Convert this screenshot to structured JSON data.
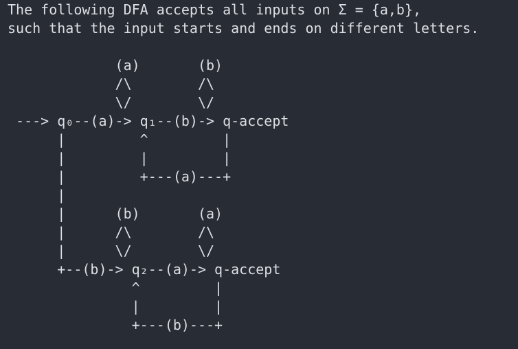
{
  "header": {
    "line1": "The following DFA accepts all inputs on Σ = {a,b},",
    "line2": "such that the input starts and ends on different letters."
  },
  "diagram": {
    "lines": [
      "             (a)       (b)",
      "             /\\        /\\",
      "             \\/        \\/",
      " ---> q₀--(a)-> q₁--(b)-> q-accept",
      "      |         ^         |",
      "      |         |         |",
      "      |         +---(a)---+",
      "      |",
      "      |      (b)       (a)",
      "      |      /\\        /\\",
      "      |      \\/        \\/",
      "      +--(b)-> q₂--(a)-> q-accept",
      "               ^         |",
      "               |         |",
      "               +---(b)---+"
    ]
  }
}
